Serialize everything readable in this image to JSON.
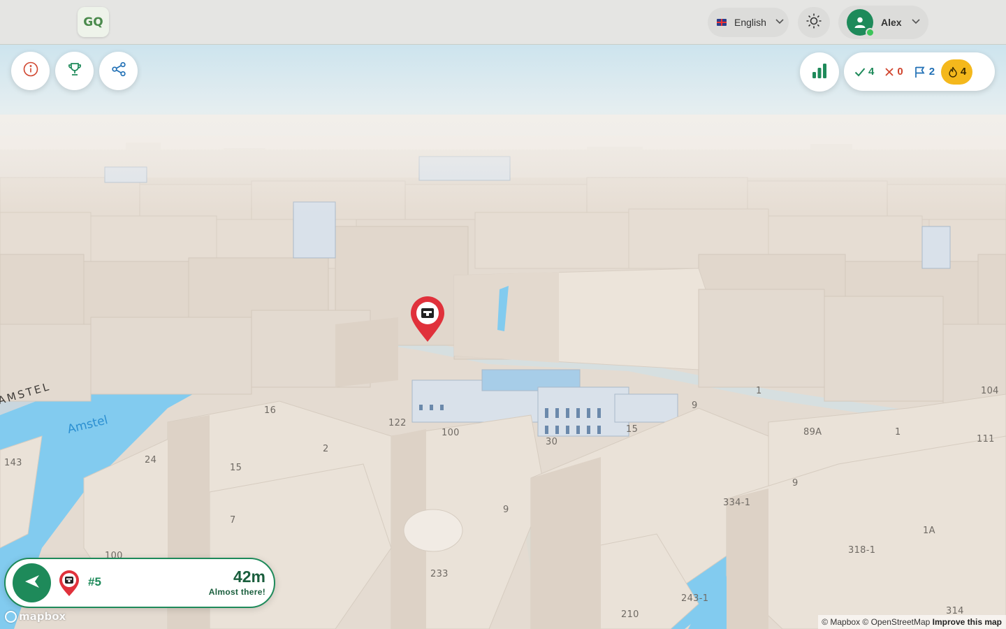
{
  "header": {
    "logo_text": "GQ",
    "language": "English",
    "user_name": "Alex"
  },
  "toolbar": {
    "info_icon": "info-icon",
    "trophy_icon": "trophy-icon",
    "share_icon": "share-icon",
    "stats_icon": "bar-chart-icon"
  },
  "score": {
    "correct": "4",
    "wrong": "0",
    "flags": "2",
    "streak": "4"
  },
  "target": {
    "number": "#5",
    "distance": "42m",
    "status": "Almost there!"
  },
  "map": {
    "street_labels": [
      "AMSTEL"
    ],
    "water_labels": [
      "Amstel"
    ],
    "house_numbers": [
      "16",
      "122",
      "100",
      "30",
      "15",
      "9",
      "1",
      "89A",
      "1",
      "104",
      "111",
      "143",
      "24",
      "15",
      "2",
      "7",
      "9",
      "334-1",
      "9",
      "1A",
      "318-1",
      "233",
      "243-1",
      "210",
      "314",
      "100"
    ]
  },
  "attribution": {
    "logo": "mapbox",
    "text": "© Mapbox © OpenStreetMap",
    "improve": "Improve this map"
  },
  "colors": {
    "brand_green": "#1e8a5a",
    "marker_red": "#e0313b",
    "streak_yellow": "#f4b81c",
    "water": "#7cc8ef",
    "buildings": "#e6ddd3"
  }
}
